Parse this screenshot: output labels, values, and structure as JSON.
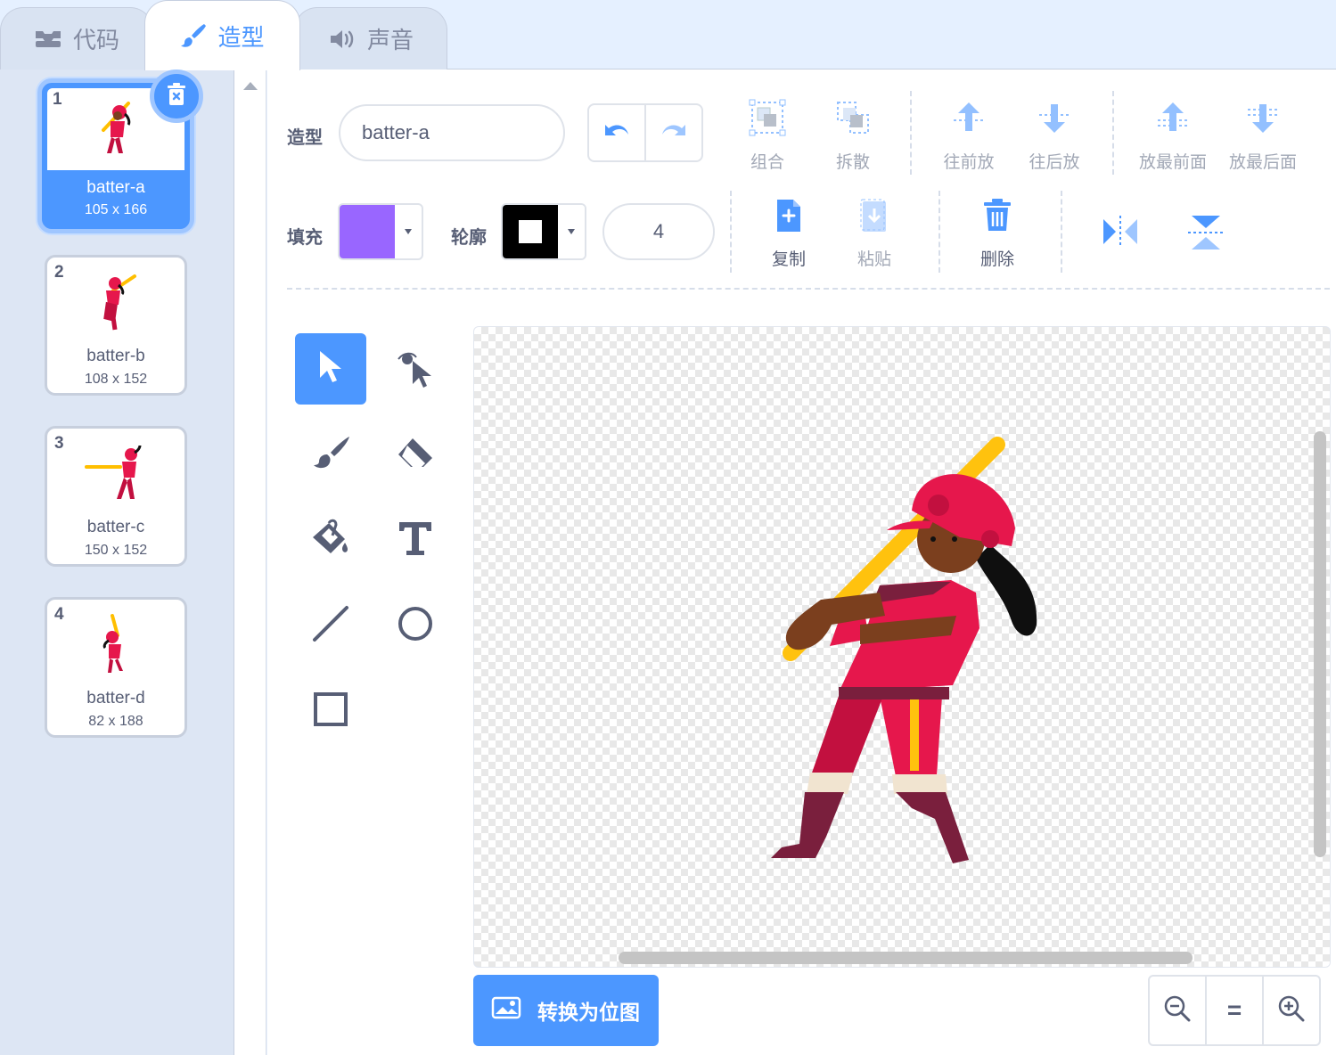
{
  "tabs": [
    {
      "label": "代码",
      "icon": "code-icon"
    },
    {
      "label": "造型",
      "icon": "brush-icon",
      "active": true
    },
    {
      "label": "声音",
      "icon": "speaker-icon"
    }
  ],
  "costumes": [
    {
      "number": "1",
      "name": "batter-a",
      "size": "105 x 166",
      "selected": true
    },
    {
      "number": "2",
      "name": "batter-b",
      "size": "108 x 152"
    },
    {
      "number": "3",
      "name": "batter-c",
      "size": "150 x 152"
    },
    {
      "number": "4",
      "name": "batter-d",
      "size": "82 x 188"
    }
  ],
  "toolbar": {
    "costume_label": "造型",
    "costume_name": "batter-a",
    "group": "组合",
    "ungroup": "拆散",
    "forward": "往前放",
    "backward": "往后放",
    "front": "放最前面",
    "back": "放最后面",
    "fill_label": "填充",
    "fill_color": "#9966ff",
    "outline_label": "轮廓",
    "outline_color": "#000000",
    "outline_width": "4",
    "copy": "复制",
    "paste": "粘贴",
    "delete": "删除"
  },
  "tools": [
    "select-tool",
    "reshape-tool",
    "brush-tool",
    "eraser-tool",
    "fill-tool",
    "text-tool",
    "line-tool",
    "circle-tool",
    "rectangle-tool"
  ],
  "convert_button": "转换为位图",
  "zoom": {
    "out": "zoom-out-icon",
    "reset": "=",
    "in": "zoom-in-icon"
  },
  "colors": {
    "accent": "#4c97ff",
    "sidebar": "#dde6f4",
    "text": "#575e75"
  }
}
